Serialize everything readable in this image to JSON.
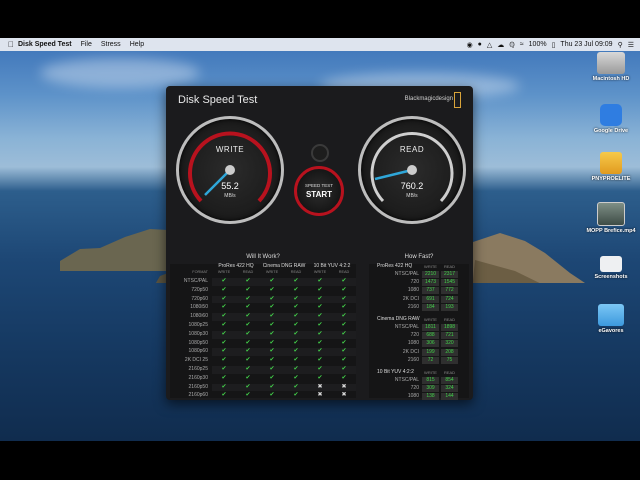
{
  "menubar": {
    "app": "Disk Speed Test",
    "menus": [
      "File",
      "Stress",
      "Help"
    ],
    "battery": "100%",
    "clock": "Thu 23 Jul  09:09"
  },
  "desktop_icons": [
    {
      "label": "Macintosh HD",
      "icon": "hard-drive-icon"
    },
    {
      "label": "Google Drive",
      "icon": "google-drive-icon"
    },
    {
      "label": "PNYPROELITE",
      "icon": "external-drive-icon"
    },
    {
      "label": "MOPP Brefice.mp4",
      "icon": "video-file-icon"
    },
    {
      "label": "Screenshots",
      "icon": "screenshot-folder-icon"
    },
    {
      "label": "eGavores",
      "icon": "folder-icon"
    }
  ],
  "window": {
    "title": "Disk Speed Test",
    "brand": "Blackmagicdesign",
    "write": {
      "label": "WRITE",
      "value": "55.2",
      "unit": "MB/s"
    },
    "read": {
      "label": "READ",
      "value": "760.2",
      "unit": "MB/s"
    },
    "start": {
      "line1": "SPEED TEST",
      "line2": "START"
    }
  },
  "will_it_work": {
    "title": "Will It Work?",
    "format_label": "FORMAT",
    "groups": [
      "ProRes 422 HQ",
      "Cinema DNG RAW",
      "10 Bit YUV 4:2:2"
    ],
    "sub": [
      "WRITE",
      "READ"
    ],
    "rows": [
      "NTSC/PAL",
      "720p50",
      "720p60",
      "1080i50",
      "1080i60",
      "1080p25",
      "1080p30",
      "1080p50",
      "1080p60",
      "2K DCI 25",
      "2160p25",
      "2160p30",
      "2160p50",
      "2160p60"
    ],
    "checks": [
      [
        1,
        1,
        1,
        1,
        1,
        1
      ],
      [
        1,
        1,
        1,
        1,
        1,
        1
      ],
      [
        1,
        1,
        1,
        1,
        1,
        1
      ],
      [
        1,
        1,
        1,
        1,
        1,
        1
      ],
      [
        1,
        1,
        1,
        1,
        1,
        1
      ],
      [
        1,
        1,
        1,
        1,
        1,
        1
      ],
      [
        1,
        1,
        1,
        1,
        1,
        1
      ],
      [
        1,
        1,
        1,
        1,
        1,
        1
      ],
      [
        1,
        1,
        1,
        1,
        1,
        1
      ],
      [
        1,
        1,
        1,
        1,
        1,
        1
      ],
      [
        1,
        1,
        1,
        1,
        1,
        1
      ],
      [
        1,
        1,
        1,
        1,
        1,
        1
      ],
      [
        1,
        1,
        1,
        1,
        0,
        0
      ],
      [
        1,
        1,
        1,
        1,
        0,
        0
      ]
    ]
  },
  "how_fast": {
    "title": "How Fast?",
    "sub": [
      "WRITE",
      "READ"
    ],
    "sections": [
      {
        "name": "ProRes 422 HQ",
        "rows": [
          {
            "label": "NTSC/PAL",
            "write": "2210",
            "read": "2317"
          },
          {
            "label": "720",
            "write": "1473",
            "read": "1545"
          },
          {
            "label": "1080",
            "write": "737",
            "read": "772"
          },
          {
            "label": "2K DCI",
            "write": "691",
            "read": "724"
          },
          {
            "label": "2160",
            "write": "184",
            "read": "193"
          }
        ]
      },
      {
        "name": "Cinema DNG RAW",
        "rows": [
          {
            "label": "NTSC/PAL",
            "write": "1811",
            "read": "1898"
          },
          {
            "label": "720",
            "write": "688",
            "read": "721"
          },
          {
            "label": "1080",
            "write": "306",
            "read": "320"
          },
          {
            "label": "2K DCI",
            "write": "199",
            "read": "208"
          },
          {
            "label": "2160",
            "write": "72",
            "read": "75"
          }
        ]
      },
      {
        "name": "10 Bit YUV 4:2:2",
        "rows": [
          {
            "label": "NTSC/PAL",
            "write": "815",
            "read": "854"
          },
          {
            "label": "720",
            "write": "309",
            "read": "324"
          },
          {
            "label": "1080",
            "write": "138",
            "read": "144"
          },
          {
            "label": "2K DCI",
            "write": "89",
            "read": "94"
          },
          {
            "label": "2160",
            "write": "32",
            "read": "34"
          }
        ]
      }
    ]
  },
  "colors": {
    "check": "#43d04a",
    "cross": "#d8d8d8",
    "accent_red": "#b8121e",
    "needle": "#2fa7d9"
  }
}
